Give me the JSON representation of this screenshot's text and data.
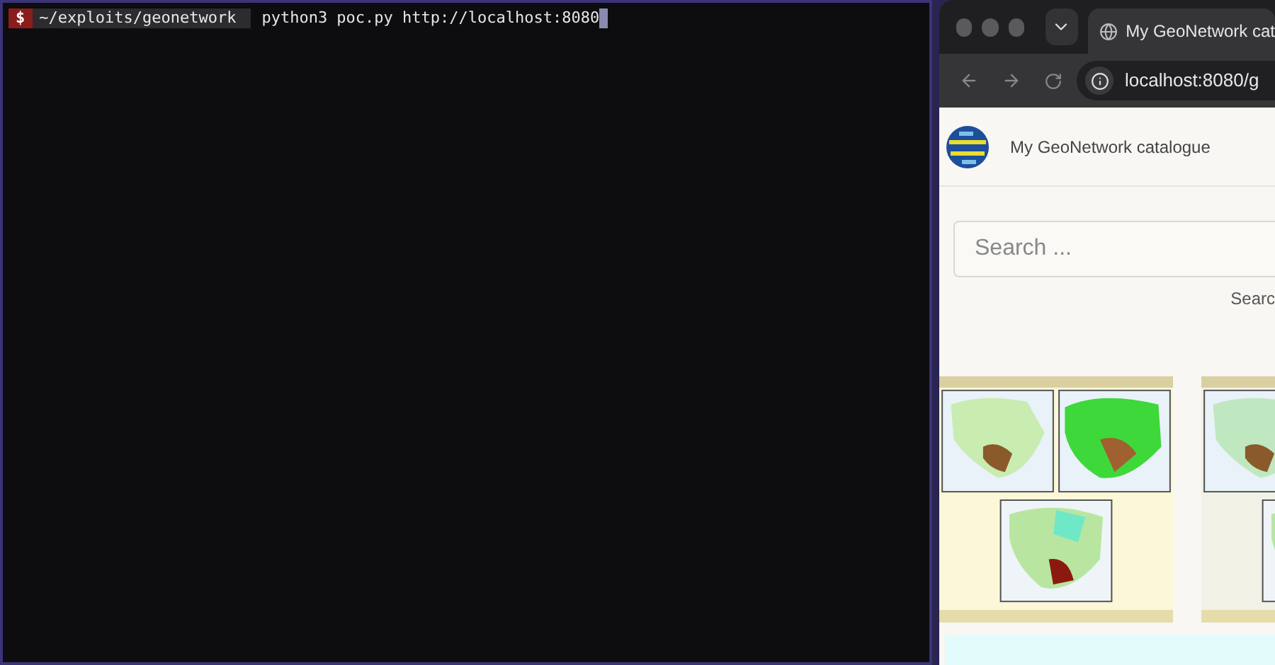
{
  "terminal": {
    "prompt_symbol": "$",
    "path": "~/exploits/geonetwork",
    "command": "python3 poc.py http://localhost:8080"
  },
  "browser": {
    "tab": {
      "title": "My GeoNetwork cat"
    },
    "address": "localhost:8080/g",
    "page": {
      "site_title": "My GeoNetwork catalogue",
      "search": {
        "placeholder": "Search ..."
      },
      "search_label": "Searc"
    }
  }
}
